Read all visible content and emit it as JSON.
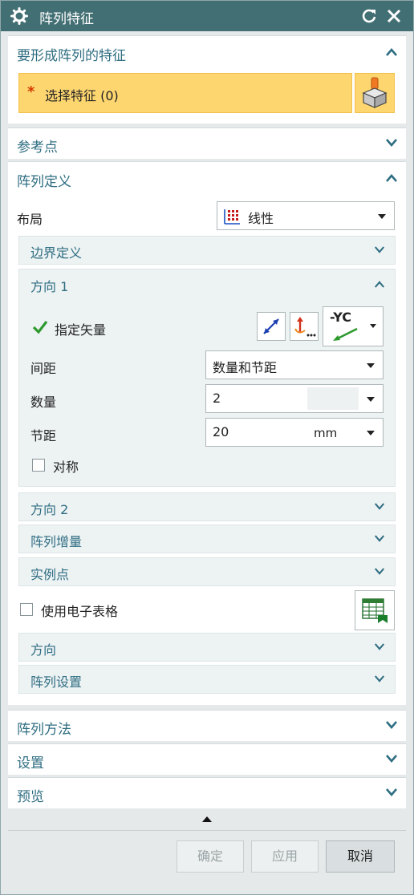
{
  "window": {
    "title": "阵列特征"
  },
  "sections": {
    "features": {
      "label": "要形成阵列的特征",
      "select_label": "选择特征 (0)",
      "required_mark": "*"
    },
    "ref_point": {
      "label": "参考点"
    },
    "definition": {
      "label": "阵列定义"
    },
    "method": {
      "label": "阵列方法"
    },
    "settings": {
      "label": "设置"
    },
    "preview": {
      "label": "预览"
    }
  },
  "layout": {
    "label": "布局",
    "value": "线性"
  },
  "subsections": {
    "boundary": "边界定义",
    "direction1": "方向 1",
    "direction2": "方向 2",
    "increment": "阵列增量",
    "instance_points": "实例点",
    "direction": "方向",
    "array_settings": "阵列设置"
  },
  "direction1": {
    "vector_label": "指定矢量",
    "vector_value": "-YC",
    "spacing_label": "间距",
    "spacing_value": "数量和节距",
    "count_label": "数量",
    "count_value": "2",
    "pitch_label": "节距",
    "pitch_value": "20",
    "pitch_unit": "mm",
    "symmetric_label": "对称"
  },
  "spreadsheet": {
    "label": "使用电子表格"
  },
  "footer": {
    "ok": "确定",
    "apply": "应用",
    "cancel": "取消"
  },
  "colors": {
    "titlebar": "#426f73",
    "section_text": "#2f6e82",
    "highlight": "#fed670"
  }
}
